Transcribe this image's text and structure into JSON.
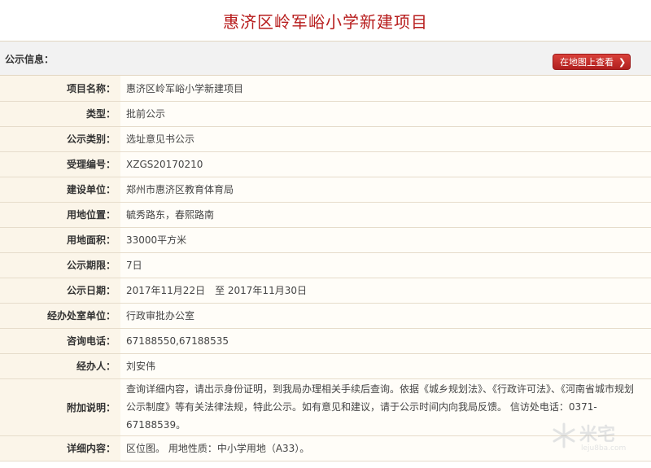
{
  "page": {
    "title": "惠济区岭军峪小学新建项目"
  },
  "notice": {
    "label": "公示信息：",
    "map_button": "在地图上查看"
  },
  "fields": [
    {
      "key": "项目名称：",
      "value": "惠济区岭军峪小学新建项目"
    },
    {
      "key": "类型：",
      "value": "批前公示"
    },
    {
      "key": "公示类别：",
      "value": "选址意见书公示"
    },
    {
      "key": "受理编号：",
      "value": "XZGS20170210"
    },
    {
      "key": "建设单位：",
      "value": "郑州市惠济区教育体育局"
    },
    {
      "key": "用地位置：",
      "value": "毓秀路东，春熙路南"
    },
    {
      "key": "用地面积：",
      "value": "33000平方米"
    },
    {
      "key": "公示期限：",
      "value": "7日"
    },
    {
      "key": "公示日期：",
      "value": "2017年11月22日　至 2017年11月30日"
    },
    {
      "key": "经办处室单位：",
      "value": "行政审批办公室"
    },
    {
      "key": "咨询电话：",
      "value": "67188550,67188535"
    },
    {
      "key": "经办人：",
      "value": "刘安伟"
    },
    {
      "key": "附加说明：",
      "value": "查询详细内容，请出示身份证明，到我局办理相关手续后查询。依据《城乡规划法》、《行政许可法》、《河南省城市规划公示制度》等有关法律法规，特此公示。如有意见和建议，请于公示时间内向我局反馈。 信访处电话：0371-67188539。"
    },
    {
      "key": "详细内容：",
      "value": "区位图。 用地性质：中小学用地（A33）。"
    }
  ],
  "watermark": {
    "text": "米宅",
    "sub": "leju8ba.com"
  },
  "colors": {
    "title": "#b71c1c",
    "button": "#c62828",
    "key_bg": "#fbf5e9",
    "border": "#e6dccb"
  }
}
